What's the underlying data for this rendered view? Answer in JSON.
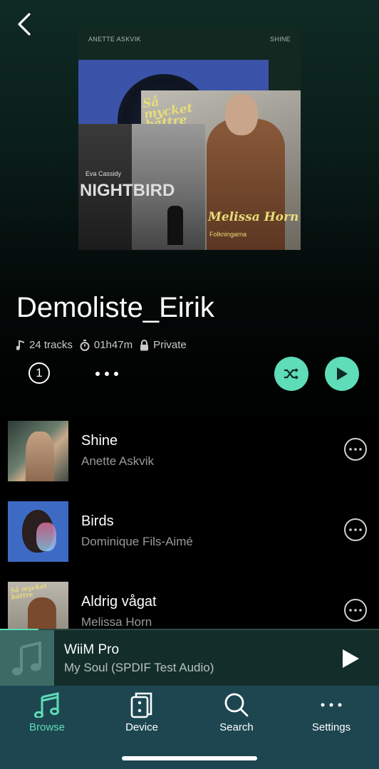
{
  "header": {
    "back_icon": "chevron-left-icon"
  },
  "collage": {
    "top_left_label": "ANETTE ASKVIK",
    "top_right_label": "SHINE",
    "melissa_title": "Så mycket bättre",
    "melissa_artist": "Melissa Horn",
    "melissa_sub": "Folkningarna",
    "night_artist": "Eva Cassidy",
    "night_title": "NIGHTBIRD"
  },
  "playlist": {
    "title": "Demoliste_Eirik",
    "tracks_count": "24 tracks",
    "duration": "01h47m",
    "privacy": "Private"
  },
  "actions": {
    "count": "1"
  },
  "tracks": [
    {
      "name": "Shine",
      "artist": "Anette Askvik"
    },
    {
      "name": "Birds",
      "artist": "Dominique Fils-Aimé"
    },
    {
      "name": "Aldrig vågat",
      "artist": "Melissa Horn"
    }
  ],
  "now_playing": {
    "device": "WiiM Pro",
    "song": "My Soul (SPDIF Test Audio)"
  },
  "tabs": [
    {
      "label": "Browse",
      "icon": "music-note-icon",
      "active": true
    },
    {
      "label": "Device",
      "icon": "speaker-icon",
      "active": false
    },
    {
      "label": "Search",
      "icon": "search-icon",
      "active": false
    },
    {
      "label": "Settings",
      "icon": "more-icon",
      "active": false
    }
  ],
  "colors": {
    "accent": "#5fdcb8",
    "tabbar": "#1d4650",
    "mini_player": "#132e2a"
  }
}
